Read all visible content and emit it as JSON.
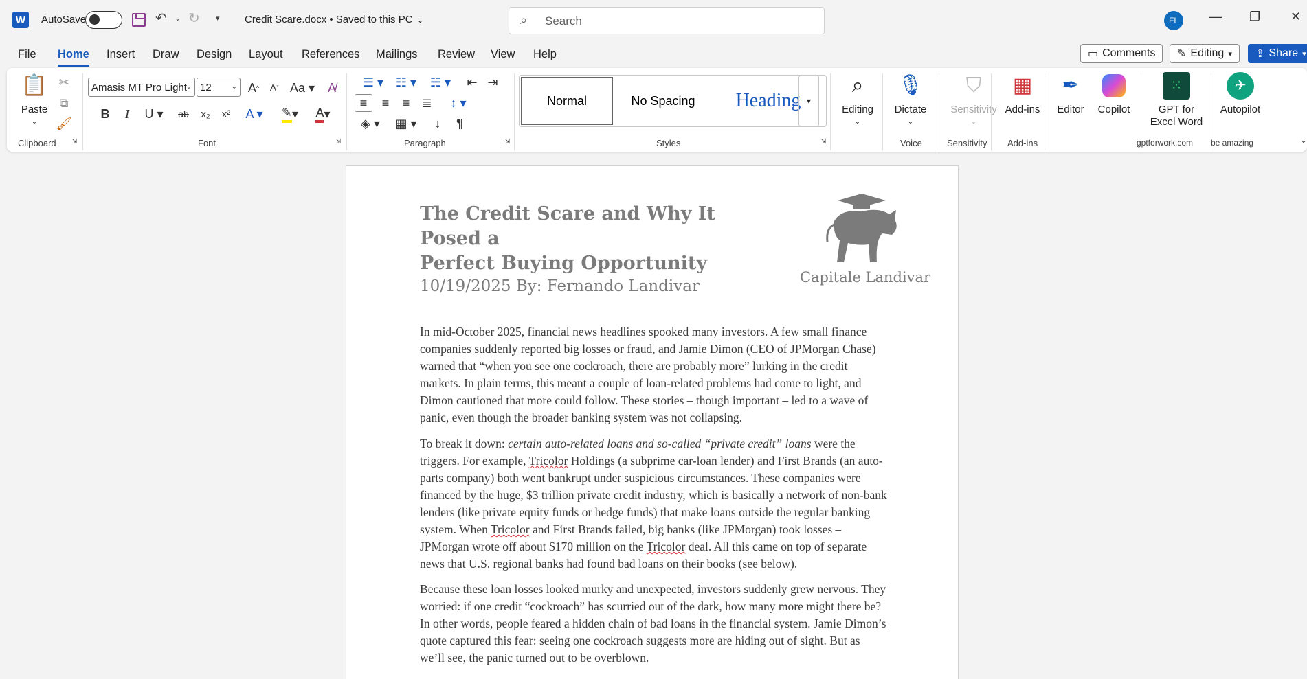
{
  "titlebar": {
    "app_letter": "W",
    "autosave_label": "AutoSave",
    "doc_title": "Credit Scare.docx • Saved to this PC",
    "search_placeholder": "Search",
    "avatar_initials": "FL"
  },
  "tabs": [
    "File",
    "Home",
    "Insert",
    "Draw",
    "Design",
    "Layout",
    "References",
    "Mailings",
    "Review",
    "View",
    "Help"
  ],
  "active_tab": "Home",
  "right_buttons": {
    "comments": "Comments",
    "editing": "Editing",
    "share": "Share"
  },
  "ribbon": {
    "clipboard": {
      "paste": "Paste",
      "label": "Clipboard"
    },
    "font": {
      "name": "Amasis MT Pro Light",
      "size": "12",
      "label": "Font"
    },
    "paragraph": {
      "label": "Paragraph"
    },
    "styles": {
      "normal": "Normal",
      "no_spacing": "No Spacing",
      "heading": "Heading",
      "label": "Styles"
    },
    "editing": {
      "label": "Editing"
    },
    "voice": {
      "dictate": "Dictate",
      "label": "Voice"
    },
    "sensitivity": {
      "btn": "Sensitivity",
      "label": "Sensitivity"
    },
    "addins": {
      "btn": "Add-ins",
      "label": "Add-ins"
    },
    "editor": "Editor",
    "copilot": "Copilot",
    "gpt": {
      "line1": "GPT for",
      "line2": "Excel Word",
      "label": "gptforwork.com"
    },
    "autopilot": {
      "btn": "Autopilot",
      "label": "be amazing"
    }
  },
  "colors": {
    "accent": "#185abd",
    "heading_gray": "#7b7b7b"
  },
  "document": {
    "title_line1": "The Credit Scare and Why It Posed a",
    "title_line2": "Perfect Buying Opportunity",
    "date_author": "10/19/2025 By: Fernando Landivar",
    "logo_text": "Capitale Landivar",
    "p1": "In mid-October 2025, financial news headlines spooked many investors. A few small finance companies suddenly reported big losses or fraud, and Jamie Dimon (CEO of JPMorgan Chase) warned that “when you see one cockroach, there are probably more” lurking in the credit markets. In plain terms, this meant a couple of loan-related problems had come to light, and Dimon cautioned that more could follow. These stories – though important – led to a wave of panic, even though the broader banking system was not collapsing.",
    "p2_start": "To break it down: ",
    "p2_italic": "certain auto-related loans and so-called “private credit” loans",
    "p2_a": " were the triggers. For example, ",
    "tricolor": "Tricolor",
    "p2_b": " Holdings (a subprime car-loan lender) and First Brands (an auto-parts company) both went bankrupt under suspicious circumstances. These companies were financed by the huge, $3 trillion private credit industry, which is basically a network of non-bank lenders (like private equity funds or hedge funds) that make loans outside the regular banking system. When ",
    "p2_c": " and First Brands failed, big banks (like JPMorgan) took losses – JPMorgan wrote off about $170 million on the ",
    "p2_d": " deal. All this came on top of separate news that U.S. regional banks had found bad loans on their books (see below).",
    "p3": "Because these loan losses looked murky and unexpected, investors suddenly grew nervous. They worried: if one credit “cockroach” has scurried out of the dark, how many more might there be? In other words, people feared a hidden chain of bad loans in the financial system. Jamie Dimon’s quote captured this fear: seeing one cockroach suggests more are hiding out of sight. But as we’ll see, the panic turned out to be overblown."
  }
}
